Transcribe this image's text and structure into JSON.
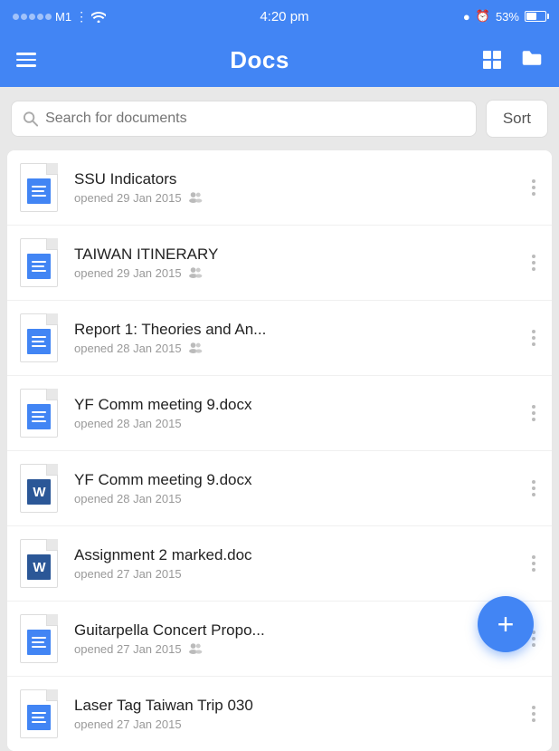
{
  "statusBar": {
    "carrier": "M1",
    "time": "4:20 pm",
    "battery": "53%"
  },
  "toolbar": {
    "title": "Docs"
  },
  "search": {
    "placeholder": "Search for documents",
    "sortLabel": "Sort"
  },
  "documents": [
    {
      "id": 1,
      "title": "SSU Indicators",
      "date": "opened 29 Jan 2015",
      "type": "gdoc",
      "shared": true
    },
    {
      "id": 2,
      "title": "TAIWAN ITINERARY",
      "date": "opened 29 Jan 2015",
      "type": "gdoc",
      "shared": true
    },
    {
      "id": 3,
      "title": "Report 1: Theories and An...",
      "date": "opened 28 Jan 2015",
      "type": "gdoc",
      "shared": true
    },
    {
      "id": 4,
      "title": "YF Comm meeting 9.docx",
      "date": "opened 28 Jan 2015",
      "type": "gdoc",
      "shared": false
    },
    {
      "id": 5,
      "title": "YF Comm meeting 9.docx",
      "date": "opened 28 Jan 2015",
      "type": "word",
      "shared": false
    },
    {
      "id": 6,
      "title": "Assignment 2 marked.doc",
      "date": "opened 27 Jan 2015",
      "type": "word",
      "shared": false
    },
    {
      "id": 7,
      "title": "Guitarpella Concert Propo...",
      "date": "opened 27 Jan 2015",
      "type": "gdoc",
      "shared": true
    },
    {
      "id": 8,
      "title": "Laser Tag Taiwan Trip 030",
      "date": "opened 27 Jan 2015",
      "type": "gdoc",
      "shared": false
    }
  ],
  "fab": {
    "label": "+"
  }
}
